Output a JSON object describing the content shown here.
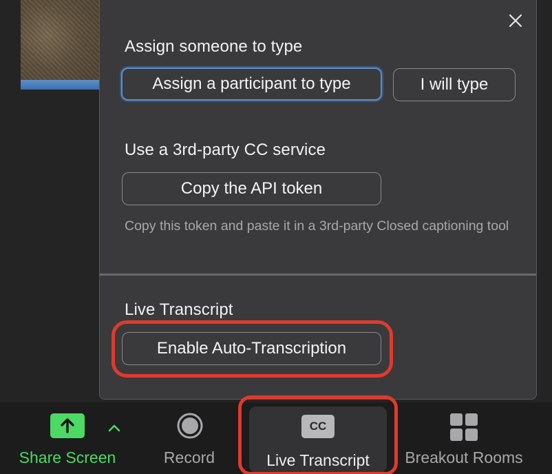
{
  "popup": {
    "close_icon": "close-icon",
    "assign": {
      "heading": "Assign someone to type",
      "participant_button": "Assign a participant to type",
      "self_button": "I will type"
    },
    "third_party": {
      "heading": "Use a 3rd-party CC service",
      "copy_button": "Copy the API token",
      "description": "Copy this token and paste it in a 3rd-party Closed captioning tool"
    },
    "live_transcript": {
      "heading": "Live Transcript",
      "enable_button": "Enable Auto-Transcription"
    }
  },
  "toolbar": {
    "share_screen": {
      "label": "Share Screen",
      "icon": "share-screen-arrow-up-icon",
      "color": "#4cd964"
    },
    "share_options": {
      "icon": "chevron-up-icon"
    },
    "record": {
      "label": "Record",
      "icon": "record-icon"
    },
    "live_transcript": {
      "label": "Live Transcript",
      "icon": "cc-icon",
      "icon_text": "CC"
    },
    "breakout_rooms": {
      "label": "Breakout Rooms",
      "icon": "breakout-rooms-grid-icon"
    }
  },
  "colors": {
    "highlight": "#e03a2c",
    "panel_bg": "#3a3a3c",
    "toolbar_bg": "#1c1c1c",
    "accent_blue": "#5b8fc9",
    "share_green": "#4cd964"
  }
}
